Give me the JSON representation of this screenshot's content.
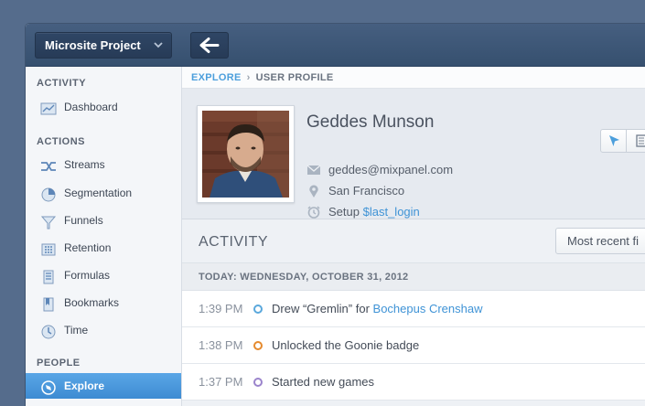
{
  "topbar": {
    "project": "Microsite Project"
  },
  "sidebar": {
    "sections": {
      "activity": "ACTIVITY",
      "actions": "ACTIONS",
      "people": "PEOPLE"
    },
    "items": [
      {
        "label": "Dashboard",
        "icon": "dashboard-icon"
      },
      {
        "label": "Streams",
        "icon": "streams-icon"
      },
      {
        "label": "Segmentation",
        "icon": "segmentation-icon"
      },
      {
        "label": "Funnels",
        "icon": "funnel-icon"
      },
      {
        "label": "Retention",
        "icon": "retention-icon"
      },
      {
        "label": "Formulas",
        "icon": "formulas-icon"
      },
      {
        "label": "Bookmarks",
        "icon": "bookmark-icon"
      },
      {
        "label": "Time",
        "icon": "clock-icon"
      },
      {
        "label": "Explore",
        "icon": "explore-icon"
      }
    ],
    "active_item": "Explore"
  },
  "breadcrumb": {
    "explore": "EXPLORE",
    "current": "USER PROFILE"
  },
  "profile": {
    "name": "Geddes Munson",
    "email": "geddes@mixpanel.com",
    "location": "San Francisco",
    "setup_label": "Setup",
    "setup_value": "$last_login"
  },
  "activity": {
    "title": "ACTIVITY",
    "sort_button": "Most recent fi",
    "date_header": "TODAY: WEDNESDAY, OCTOBER 31, 2012",
    "rows": [
      {
        "time": "1:39 PM",
        "text": "Drew “Gremlin” for",
        "link": "Bochepus Crenshaw",
        "color": "#5aa8dc"
      },
      {
        "time": "1:38 PM",
        "text": "Unlocked the Goonie badge",
        "link": "",
        "color": "#e58a2e"
      },
      {
        "time": "1:37 PM",
        "text": "Started new games",
        "link": "",
        "color": "#9b84cc"
      }
    ]
  },
  "colors": {
    "accent": "#4c9fdc",
    "topbar": "#3d5676",
    "active_nav": "#4a98dc"
  }
}
